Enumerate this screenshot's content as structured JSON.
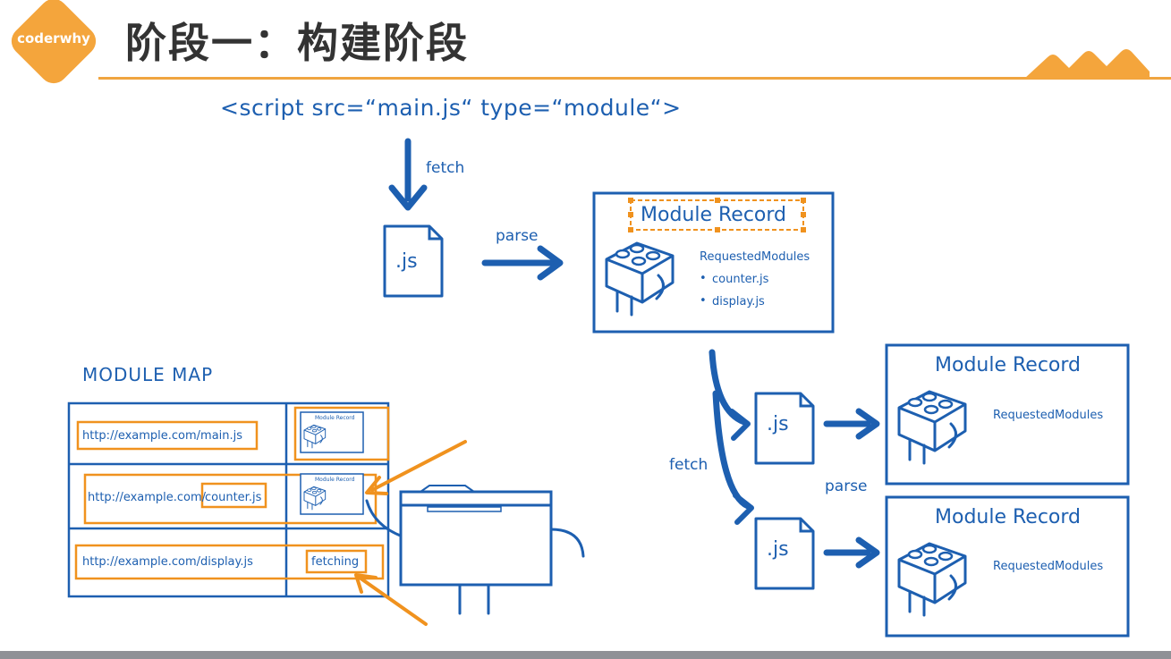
{
  "header": {
    "logo_text": "coderwhy",
    "title": "阶段一：构建阶段"
  },
  "diagram": {
    "script_tag": "<script src=“main.js“ type=“module“>",
    "fetch_label": "fetch",
    "parse_label": "parse",
    "file_label": ".js",
    "main_record": {
      "title": "Module Record",
      "requested_title": "RequestedModules",
      "requested_items": [
        "counter.js",
        "display.js"
      ]
    },
    "child_records": [
      {
        "title": "Module Record",
        "requested_title": "RequestedModules"
      },
      {
        "title": "Module Record",
        "requested_title": "RequestedModules"
      }
    ],
    "child_fetch_label": "fetch",
    "child_parse_label": "parse",
    "child_file_labels": [
      ".js",
      ".js"
    ],
    "module_map": {
      "title": "MODULE MAP",
      "rows": [
        {
          "url": "http://example.com/main.js",
          "state": "Module Record"
        },
        {
          "url_prefix": "http://example.com/",
          "url_suffix": "counter.js",
          "state": "Module Record"
        },
        {
          "url": "http://example.com/display.js",
          "state": "fetching"
        }
      ]
    },
    "colors": {
      "ink": "#1d5fb0",
      "highlight": "#f0921e",
      "accent": "#f4a53c"
    }
  }
}
